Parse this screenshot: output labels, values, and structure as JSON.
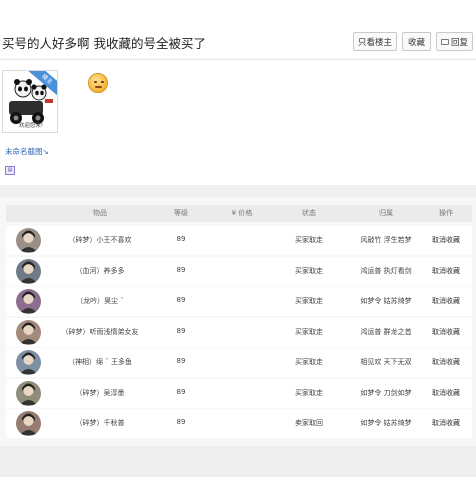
{
  "header": {
    "title": "买号的人好多啊 我收藏的号全被买了",
    "buttons": {
      "only_louzhu": "只看楼主",
      "collect": "收藏",
      "reply": "回复"
    }
  },
  "post": {
    "image_caption": "欢迎您来!",
    "ribbon": "楼主",
    "unnamed_link": "未命名截图↘",
    "badge_icon": "badge-icon"
  },
  "table": {
    "headers": [
      "物品",
      "等级",
      "¥ 价格",
      "状态",
      "归属",
      "操作"
    ],
    "rows": [
      {
        "name": "（碎梦）小王不喜欢",
        "level": "89",
        "price": "",
        "status": "买家取走",
        "owner": "风敲竹 浮生若梦",
        "action": "取消收藏",
        "avatar_color": "#9a8f86"
      },
      {
        "name": "（血河）养多多",
        "level": "89",
        "price": "",
        "status": "买家取走",
        "owner": "鸿运普 执灯看剑",
        "action": "取消收藏",
        "avatar_color": "#6f7a86"
      },
      {
        "name": "（龙吟）昊尘 ˇ",
        "level": "89",
        "price": "",
        "status": "买家取走",
        "owner": "如梦令 姑苏绮梦",
        "action": "取消收藏",
        "avatar_color": "#8c6d8f"
      },
      {
        "name": "（碎梦）听雨浅情弟女友",
        "level": "89",
        "price": "",
        "status": "买家取走",
        "owner": "鸿运普 群龙之首",
        "action": "取消收藏",
        "avatar_color": "#a38a7a"
      },
      {
        "name": "（神相）绵 ˇ 王多鱼",
        "level": "89",
        "price": "",
        "status": "买家取走",
        "owner": "相见欢 天下无双",
        "action": "取消收藏",
        "avatar_color": "#7d8fa5"
      },
      {
        "name": "（碎梦）吴淳墨",
        "level": "89",
        "price": "",
        "status": "买家取走",
        "owner": "如梦令 刀剑如梦",
        "action": "取消收藏",
        "avatar_color": "#8e8e7a"
      },
      {
        "name": "（碎梦）千秋普",
        "level": "89",
        "price": "",
        "status": "卖家取回",
        "owner": "如梦令 姑苏绮梦",
        "action": "取消收藏",
        "avatar_color": "#957b70"
      }
    ]
  }
}
